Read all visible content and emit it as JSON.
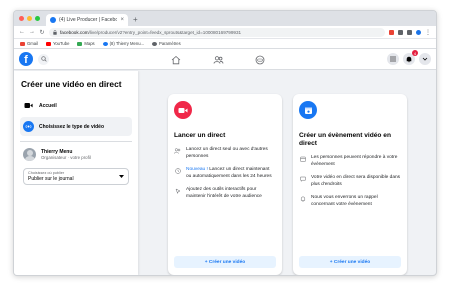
{
  "browser": {
    "tab_title": "(4) Live Producer | Facebook",
    "tab_close": "×",
    "new_tab": "+",
    "url_host": "facebook.com",
    "url_rest": "/live/producer/v2?entry_point=feedx_sprouts&target_id=100080169799931",
    "nav_back": "←",
    "nav_forward": "→",
    "nav_reload": "↻",
    "bookmarks": [
      {
        "label": "Gmail",
        "color": "#ea4335"
      },
      {
        "label": "YouTube",
        "color": "#ff0000"
      },
      {
        "label": "Maps",
        "color": "#34a853"
      },
      {
        "label": "(8) Thierry Menu...",
        "color": "#1877f2"
      },
      {
        "label": "Paramètres",
        "color": "#5f6368"
      }
    ]
  },
  "fb_nav": {
    "logo": "f",
    "notifications_badge": "4"
  },
  "sidebar": {
    "title": "Créer une vidéo en direct",
    "items": [
      {
        "label": "Accueil",
        "icon": "video-camera-icon"
      },
      {
        "label": "Choisissez le type de vidéo",
        "icon": "stream-icon"
      }
    ],
    "profile": {
      "name": "Thierry Menu",
      "role": "Organisateur · votre profil"
    },
    "publish_select": {
      "label": "Choisissez où publier",
      "value": "Publier sur le journal"
    }
  },
  "cards": [
    {
      "title": "Lancer un direct",
      "icon_color": "#f02849",
      "features": [
        {
          "new": "",
          "text": "Lancez un direct seul ou avec d'autres personnes",
          "icon": "people-icon"
        },
        {
          "new": "Nouveau !",
          "text": " Lancez un direct maintenant ou automatiquement dans les 24 heures",
          "icon": "clock-icon"
        },
        {
          "new": "",
          "text": "Ajoutez des outils interactifs pour maintenir l'intérêt de votre audience",
          "icon": "cursor-icon"
        }
      ],
      "cta": "+ Créer une vidéo"
    },
    {
      "title": "Créer un évènement vidéo en direct",
      "icon_color": "#1877f2",
      "features": [
        {
          "new": "",
          "text": "Les personnes peuvent répondre à votre évènement",
          "icon": "calendar-icon"
        },
        {
          "new": "",
          "text": "Votre vidéo en direct sera disponible dans plus d'endroits",
          "icon": "chat-icon"
        },
        {
          "new": "",
          "text": "Nous vous enverrons un rappel concernant votre évènement",
          "icon": "bell-icon"
        }
      ],
      "cta": "+ Créer une vidéo"
    }
  ],
  "colors": {
    "brand": "#1877f2",
    "live_red": "#f02849",
    "background": "#f0f2f5"
  }
}
